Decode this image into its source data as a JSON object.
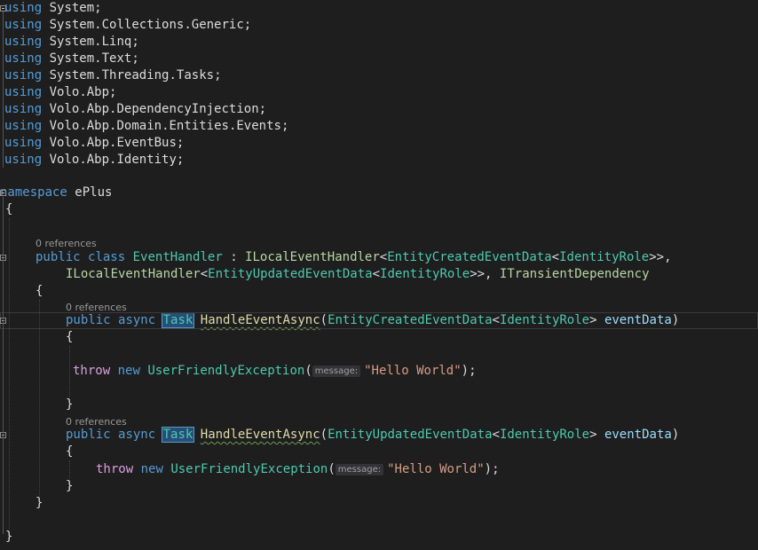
{
  "editor": {
    "usings": [
      {
        "kw": "using",
        "parts": [
          "System"
        ]
      },
      {
        "kw": "using",
        "parts": [
          "System",
          "Collections",
          "Generic"
        ]
      },
      {
        "kw": "using",
        "parts": [
          "System",
          "Linq"
        ]
      },
      {
        "kw": "using",
        "parts": [
          "System",
          "Text"
        ]
      },
      {
        "kw": "using",
        "parts": [
          "System",
          "Threading",
          "Tasks"
        ]
      },
      {
        "kw": "using",
        "parts": [
          "Volo",
          "Abp"
        ]
      },
      {
        "kw": "using",
        "parts": [
          "Volo",
          "Abp",
          "DependencyInjection"
        ]
      },
      {
        "kw": "using",
        "parts": [
          "Volo",
          "Abp",
          "Domain",
          "Entities",
          "Events"
        ]
      },
      {
        "kw": "using",
        "parts": [
          "Volo",
          "Abp",
          "EventBus"
        ]
      },
      {
        "kw": "using",
        "parts": [
          "Volo",
          "Abp",
          "Identity"
        ]
      }
    ],
    "namespace_kw": "namespace",
    "namespace_name": "ePlus",
    "open_brace": "{",
    "close_brace": "}",
    "codelens_refs": "0 references",
    "class_decl": {
      "public": "public",
      "class": "class",
      "name": "EventHandler",
      "colon": " : ",
      "iface1": "ILocalEventHandler",
      "type_created": "EntityCreatedEventData",
      "type_updated": "EntityUpdatedEventData",
      "type_role": "IdentityRole",
      "lt": "<",
      "gt2": ">>",
      "comma": ",",
      "iface2": "ITransientDependency"
    },
    "method": {
      "public": "public",
      "async": "async",
      "task": "Task",
      "name": "HandleEventAsync",
      "param": "eventData",
      "paren_open": "(",
      "paren_close": ")"
    },
    "body": {
      "throw": "throw",
      "new": "new",
      "exception": "UserFriendlyException",
      "hint": "message:",
      "string": "\"Hello World\"",
      "end": ");"
    }
  }
}
